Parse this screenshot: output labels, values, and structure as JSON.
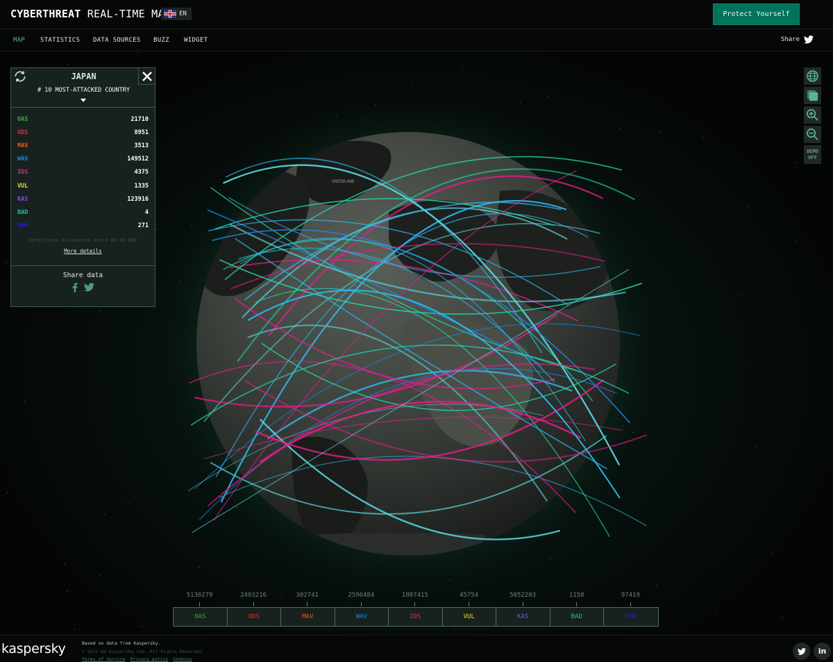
{
  "header": {
    "title_bold": "CYBERTHREAT",
    "title_rest": " REAL-TIME MAP",
    "language": "EN",
    "language_icon": "uk-flag-icon",
    "cta_label": "Protect Yourself"
  },
  "nav": {
    "items": [
      {
        "label": "MAP",
        "active": true
      },
      {
        "label": "STATISTICS",
        "active": false
      },
      {
        "label": "DATA SOURCES",
        "active": false
      },
      {
        "label": "BUZZ",
        "active": false
      },
      {
        "label": "WIDGET",
        "active": false
      }
    ],
    "share_label": "Share",
    "share_icon": "twitter-icon"
  },
  "country_panel": {
    "country": "JAPAN",
    "rank_text": "# 10 MOST-ATTACKED COUNTRY",
    "rows": [
      {
        "code": "OAS",
        "value": "21710",
        "color": "#3fae3f"
      },
      {
        "code": "ODS",
        "value": "8951",
        "color": "#e8282f"
      },
      {
        "code": "MAV",
        "value": "3513",
        "color": "#f05a1e"
      },
      {
        "code": "WAV",
        "value": "149512",
        "color": "#1f86e8"
      },
      {
        "code": "IDS",
        "value": "4375",
        "color": "#e81c8c"
      },
      {
        "code": "VUL",
        "value": "1335",
        "color": "#e8e02a"
      },
      {
        "code": "KAS",
        "value": "123916",
        "color": "#8a4ae8"
      },
      {
        "code": "BAD",
        "value": "4",
        "color": "#18c49a"
      },
      {
        "code": "RMW",
        "value": "271",
        "color": "#1c1ce0"
      }
    ],
    "since_text": "Detections discovered since 00:00 GMT",
    "more_details": "More details",
    "share_label": "Share data"
  },
  "tools": {
    "demo_line1": "DEMO",
    "demo_line2": "OFF"
  },
  "legend": {
    "items": [
      {
        "code": "OAS",
        "count": "5130279",
        "color": "#3fae3f"
      },
      {
        "code": "ODS",
        "count": "2403216",
        "color": "#e8282f"
      },
      {
        "code": "MAV",
        "count": "302741",
        "color": "#f05a1e"
      },
      {
        "code": "WAV",
        "count": "2596484",
        "color": "#1f86e8"
      },
      {
        "code": "IDS",
        "count": "1807415",
        "color": "#e81c8c"
      },
      {
        "code": "VUL",
        "count": "45754",
        "color": "#e8e02a"
      },
      {
        "code": "KAS",
        "count": "5052203",
        "color": "#8a4ae8"
      },
      {
        "code": "BAD",
        "count": "1158",
        "color": "#18c49a"
      },
      {
        "code": "RMW",
        "count": "97419",
        "color": "#1c1ce0"
      }
    ]
  },
  "footer": {
    "brand": "kaspersky",
    "based_on": "Based on data from Kaspersky.",
    "copyright": "© 2021 AO Kaspersky Lab. All Rights Reserved.",
    "links": [
      "Terms of Service",
      "Privacy policy",
      "Cookies"
    ]
  },
  "globe": {
    "label": "GREENLAND",
    "arc_colors": [
      "#2fb8f0",
      "#1f86e8",
      "#22d8a8",
      "#e81c8c",
      "#5ad8e0"
    ]
  }
}
